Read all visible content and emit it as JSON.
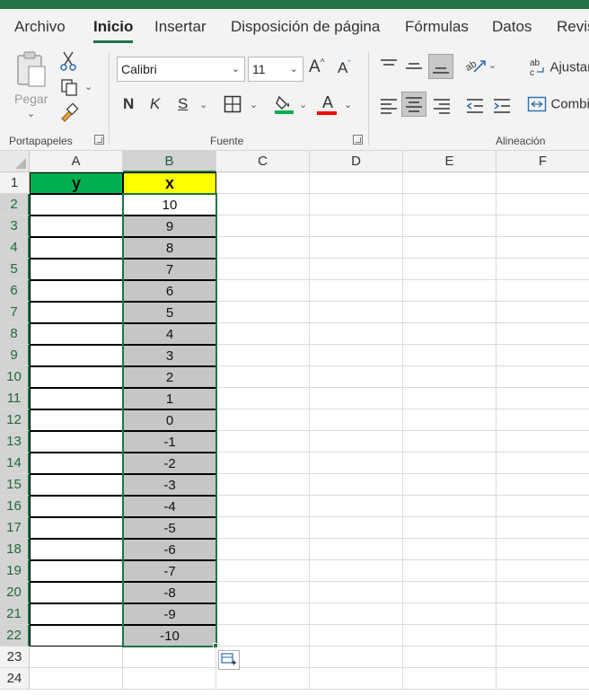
{
  "menu": {
    "tabs": [
      {
        "label": "Archivo",
        "active": false
      },
      {
        "label": "Inicio",
        "active": true
      },
      {
        "label": "Insertar",
        "active": false
      },
      {
        "label": "Disposición de página",
        "active": false
      },
      {
        "label": "Fórmulas",
        "active": false
      },
      {
        "label": "Datos",
        "active": false
      },
      {
        "label": "Revis",
        "active": false
      }
    ]
  },
  "ribbon": {
    "clipboard": {
      "paste_label": "Pegar",
      "group_label": "Portapapeles"
    },
    "font": {
      "font_name": "Calibri",
      "font_size": "11",
      "bold_label": "N",
      "italic_label": "K",
      "underline_label": "S",
      "font_color_label": "A",
      "fill_color": "#00b050",
      "font_color": "#ff0000",
      "group_label": "Fuente"
    },
    "alignment": {
      "wrap_label": "Ajustar",
      "merge_label": "Combi",
      "group_label": "Alineación"
    }
  },
  "sheet": {
    "columns": [
      "A",
      "B",
      "C",
      "D",
      "E",
      "F"
    ],
    "selected_column": "B",
    "header_row": {
      "a": "y",
      "b": "x",
      "a_fill": "#00b050",
      "b_fill": "#ffff00"
    },
    "rows": [
      "1",
      "2",
      "3",
      "4",
      "5",
      "6",
      "7",
      "8",
      "9",
      "10",
      "11",
      "12",
      "13",
      "14",
      "15",
      "16",
      "17",
      "18",
      "19",
      "20",
      "21",
      "22",
      "23",
      "24"
    ],
    "x_values": [
      "10",
      "9",
      "8",
      "7",
      "6",
      "5",
      "4",
      "3",
      "2",
      "1",
      "0",
      "-1",
      "-2",
      "-3",
      "-4",
      "-5",
      "-6",
      "-7",
      "-8",
      "-9",
      "-10"
    ]
  },
  "icons": {
    "paste": "clipboard-icon",
    "cut": "scissors-icon",
    "copy": "copy-icon",
    "format_painter": "brush-icon",
    "quick_fill": "flash-fill-icon"
  }
}
